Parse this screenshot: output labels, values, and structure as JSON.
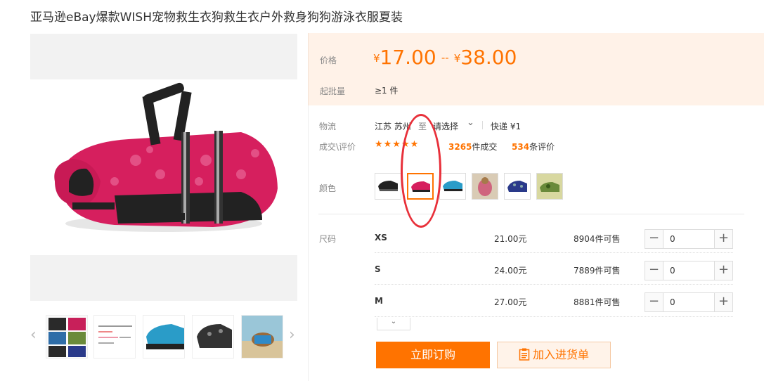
{
  "product": {
    "title": "亚马逊eBay爆款WISH宠物救生衣狗救生衣户外救身狗狗游泳衣服夏装"
  },
  "gallery": {
    "prev_arrow": "‹",
    "next_arrow": "›",
    "thumbnails": [
      "collage-thumbnail",
      "certificate-thumbnail",
      "blue-vest-thumbnail",
      "black-vest-thumbnail",
      "dog-on-beach-thumbnail"
    ]
  },
  "price": {
    "label": "价格",
    "currency": "¥",
    "min": "17.00",
    "dash": "--",
    "max": "38.00",
    "moq_label": "起批量",
    "moq_value": "≥1 件"
  },
  "logistics": {
    "label": "物流",
    "from": "江苏 苏州",
    "to_word": "至",
    "select_placeholder": "请选择",
    "express": "快递 ¥1"
  },
  "reviews": {
    "label": "成交\\评价",
    "stars": "★★★★★",
    "deals_count": "3265",
    "deals_suffix": "件成交",
    "review_count": "534",
    "review_suffix": "条评价"
  },
  "color": {
    "label": "颜色",
    "swatches": [
      "black",
      "pink",
      "blue",
      "tan",
      "navy",
      "camo"
    ],
    "selected_index": 1
  },
  "size": {
    "label": "尺码",
    "rows": [
      {
        "size": "XS",
        "price": "21.00元",
        "stock": "8904件可售",
        "qty": "0"
      },
      {
        "size": "S",
        "price": "24.00元",
        "stock": "7889件可售",
        "qty": "0"
      },
      {
        "size": "M",
        "price": "27.00元",
        "stock": "8881件可售",
        "qty": "0"
      }
    ],
    "minus": "−",
    "plus": "+",
    "expand_icon": "⌄"
  },
  "actions": {
    "buy_now": "立即订购",
    "add_to_list": "加入进货单"
  },
  "colors": {
    "accent": "#ff7300",
    "price_band_bg": "#fff2e8",
    "annotation": "#e8303a"
  }
}
